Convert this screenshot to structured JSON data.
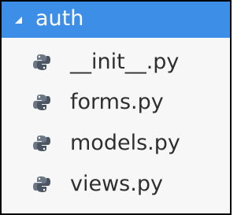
{
  "tree": {
    "folder": {
      "label": "auth",
      "expanded": true,
      "icon": "expanded-arrow-icon"
    },
    "files": [
      {
        "label": "__init__.py",
        "icon": "python-file-icon"
      },
      {
        "label": "forms.py",
        "icon": "python-file-icon"
      },
      {
        "label": "models.py",
        "icon": "python-file-icon"
      },
      {
        "label": "views.py",
        "icon": "python-file-icon"
      }
    ]
  },
  "colors": {
    "selection": "#3d8ee6",
    "background": "#f7f7f7",
    "text": "#2f2f2f",
    "icon_grey": "#6b7784",
    "icon_dark": "#4a5561"
  }
}
